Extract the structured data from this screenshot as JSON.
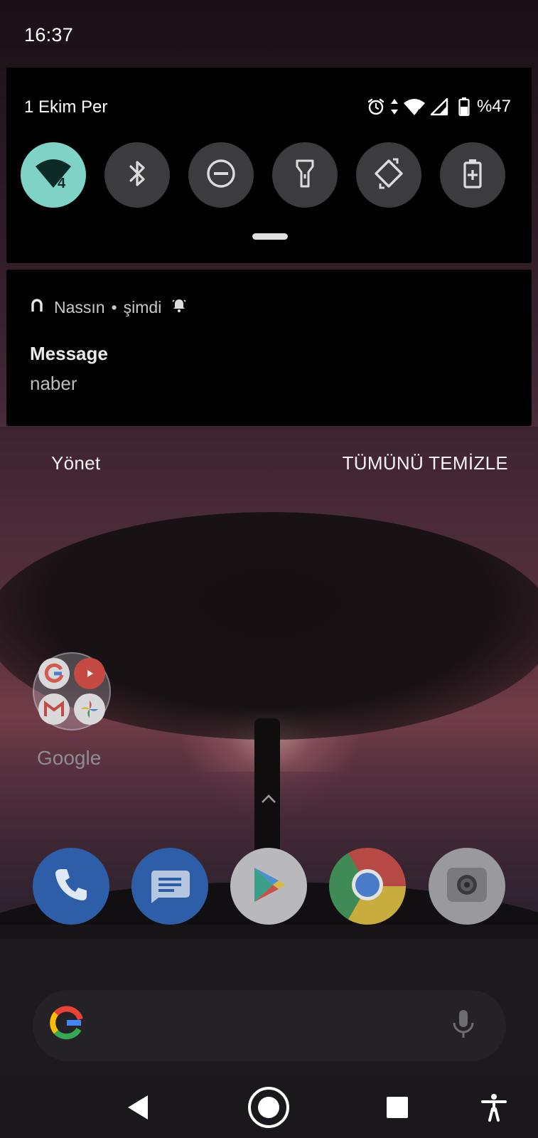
{
  "status_bar": {
    "time": "16:37",
    "date": "1 Ekim Per",
    "battery_percent": "%47",
    "icons": [
      "alarm-icon",
      "data-arrows-icon",
      "wifi-4-icon",
      "cell-signal-icon",
      "battery-icon"
    ]
  },
  "quick_settings": {
    "tiles": [
      {
        "name": "wifi-tile",
        "icon": "wifi-4-icon",
        "active": true
      },
      {
        "name": "bluetooth-tile",
        "icon": "bluetooth-icon",
        "active": false
      },
      {
        "name": "do-not-disturb-tile",
        "icon": "do-not-disturb-icon",
        "active": false
      },
      {
        "name": "flashlight-tile",
        "icon": "flashlight-icon",
        "active": false
      },
      {
        "name": "auto-rotate-tile",
        "icon": "auto-rotate-icon",
        "active": false
      },
      {
        "name": "battery-saver-tile",
        "icon": "battery-saver-icon",
        "active": false
      }
    ],
    "accent_color": "#7ed2c6"
  },
  "notification": {
    "app_name": "Nassın",
    "separator": "•",
    "time": "şimdi",
    "title": "Message",
    "body": "naber"
  },
  "shade_actions": {
    "manage": "Yönet",
    "clear_all": "TÜMÜNÜ TEMİZLE"
  },
  "home": {
    "folder": {
      "label": "Google",
      "apps": [
        "google-icon",
        "youtube-icon",
        "gmail-icon",
        "photos-icon"
      ]
    },
    "dock": [
      "phone-icon",
      "messages-icon",
      "play-store-icon",
      "chrome-icon",
      "camera-icon"
    ],
    "search": {
      "logo": "google-g-icon",
      "mic": "mic-icon"
    }
  },
  "navigation": [
    "back-icon",
    "home-icon",
    "recents-icon",
    "accessibility-icon"
  ]
}
